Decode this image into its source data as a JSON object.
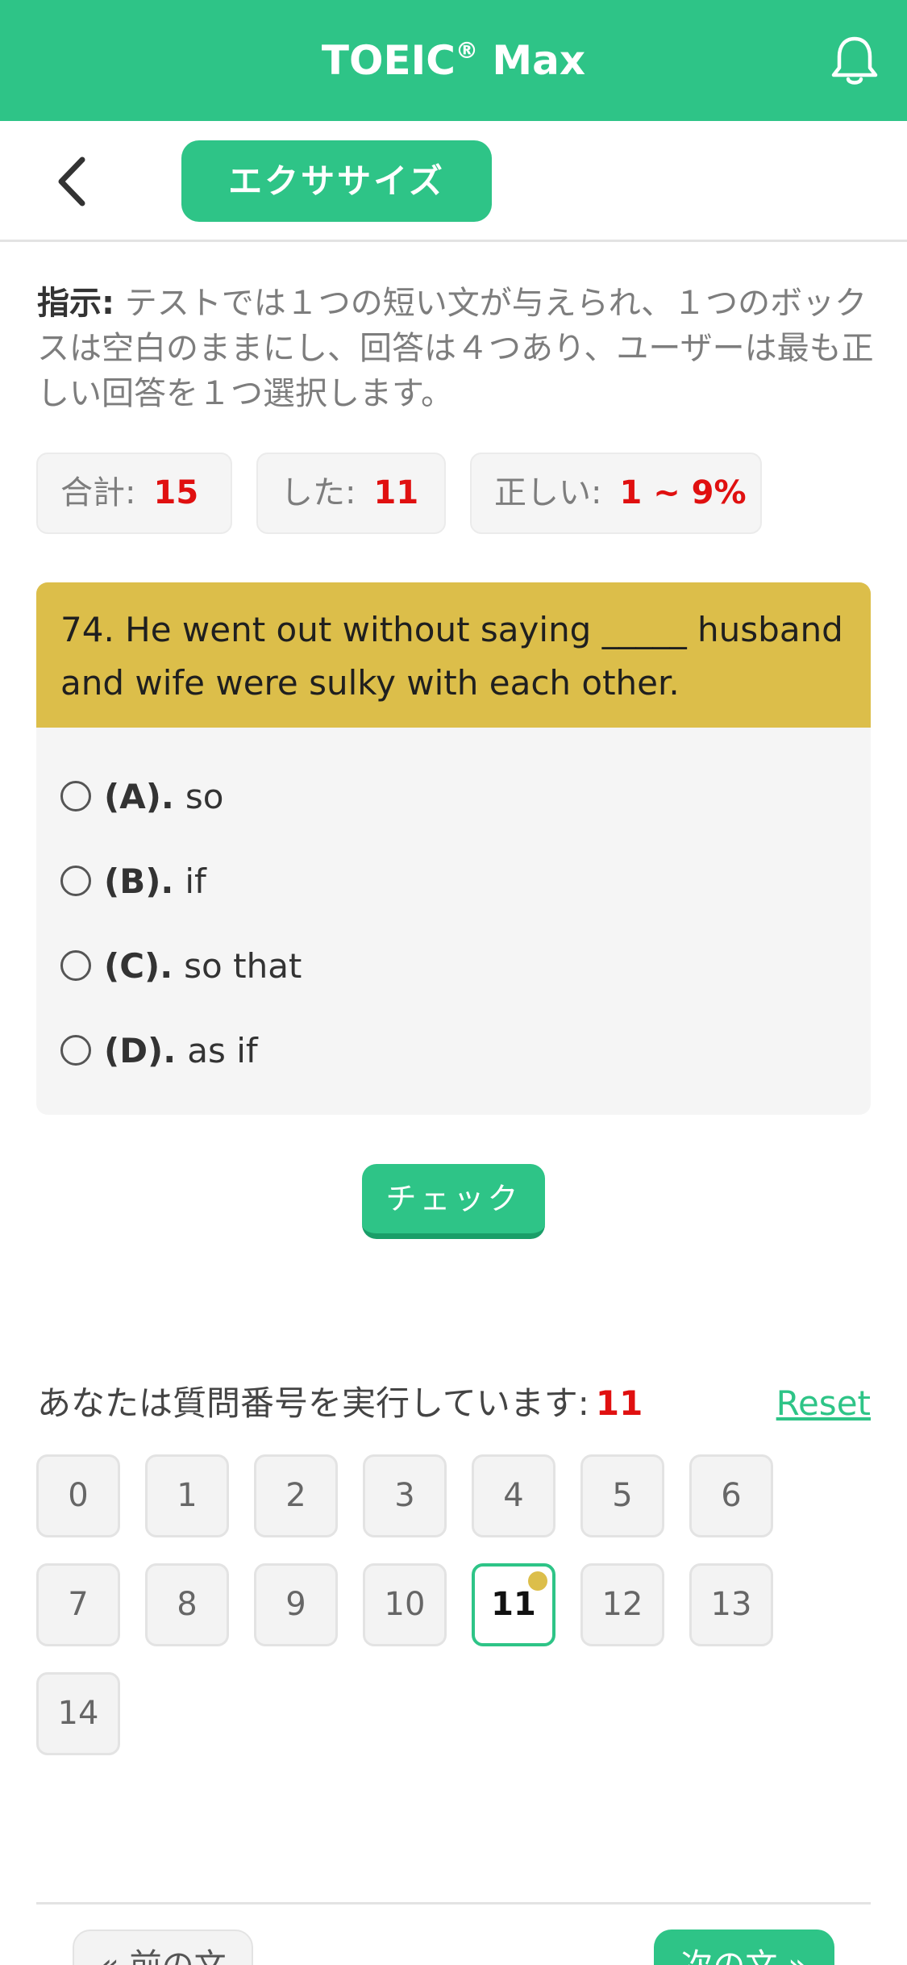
{
  "app": {
    "title": "TOEIC",
    "title_mark": "®",
    "title_suffix": " Max"
  },
  "subbar": {
    "tab_label": "エクササイズ"
  },
  "instructions": {
    "label": "指示:",
    "text": " テストでは１つの短い文が与えられ、１つのボックスは空白のままにし、回答は４つあり、ユーザーは最も正しい回答を１つ選択します。"
  },
  "stats": {
    "total_label": "合計:",
    "total_value": "15",
    "done_label": "した:",
    "done_value": "11",
    "correct_label": "正しい:",
    "correct_value": "1 ~ 9%"
  },
  "question": {
    "text": "74. He went out without saying _____ husband and wife were sulky with each other.",
    "options": [
      {
        "letter": "(A).",
        "text": "so"
      },
      {
        "letter": "(B).",
        "text": "if"
      },
      {
        "letter": "(C).",
        "text": "so that"
      },
      {
        "letter": "(D).",
        "text": "as if"
      }
    ]
  },
  "check_button": "チェック",
  "progress": {
    "label": "あなたは質問番号を実行しています:",
    "current": "11",
    "reset": "Reset"
  },
  "numbers": [
    "0",
    "1",
    "2",
    "3",
    "4",
    "5",
    "6",
    "7",
    "8",
    "9",
    "10",
    "11",
    "12",
    "13",
    "14"
  ],
  "active_number": "11",
  "nav": {
    "prev": "« 前の文",
    "next": "次の文 »"
  },
  "colors": {
    "primary": "#2ec487",
    "question_bg": "#dcbe4a",
    "accent_red": "#e01010"
  }
}
